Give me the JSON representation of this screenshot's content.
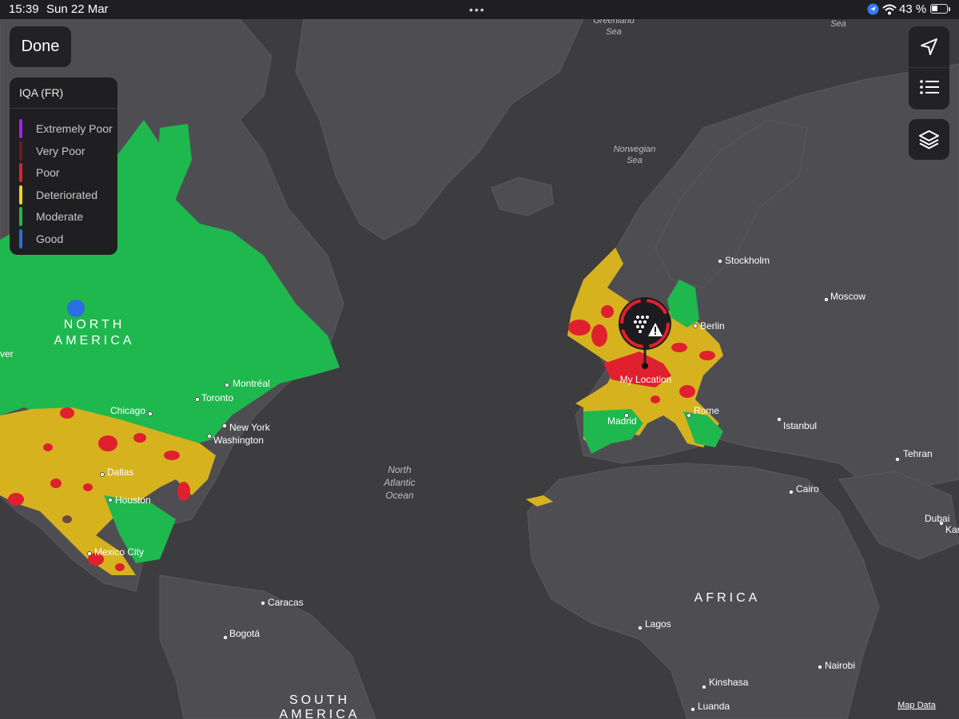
{
  "status_bar": {
    "time": "15:39",
    "date": "Sun 22 Mar",
    "battery_text": "43 %",
    "battery_level": 0.43
  },
  "done_button": {
    "label": "Done"
  },
  "legend": {
    "title": "IQA (FR)",
    "items": [
      {
        "label": "Extremely Poor",
        "color": "#a020f0"
      },
      {
        "label": "Very Poor",
        "color": "#6b1a1f"
      },
      {
        "label": "Poor",
        "color": "#e0202e"
      },
      {
        "label": "Deteriorated",
        "color": "#f2d024"
      },
      {
        "label": "Moderate",
        "color": "#1fb84e"
      },
      {
        "label": "Good",
        "color": "#2a6fe0"
      }
    ]
  },
  "map": {
    "region_labels": {
      "north_america": [
        "NORTH",
        "AMERICA"
      ],
      "south_america": [
        "SOUTH",
        "AMERICA"
      ],
      "africa": "AFRICA"
    },
    "water_labels": {
      "greenland_sea": [
        "Greenland",
        "Sea"
      ],
      "norwegian_sea": [
        "Norwegian",
        "Sea"
      ],
      "north_atlantic": [
        "North",
        "Atlantic",
        "Ocean"
      ],
      "sea_partial": "Sea"
    },
    "cities": {
      "montreal": "Montréal",
      "toronto": "Toronto",
      "chicago": "Chicago",
      "new_york": "New York",
      "washington": "Washington",
      "dallas": "Dallas",
      "houston": "Houston",
      "mexico_city": "Mexico City",
      "caracas": "Caracas",
      "bogota": "Bogotá",
      "stockholm": "Stockholm",
      "moscow": "Moscow",
      "berlin": "Berlin",
      "madrid": "Madrid",
      "rome": "Rome",
      "istanbul": "Istanbul",
      "tehran": "Tehran",
      "cairo": "Cairo",
      "dubai": "Dubai",
      "karachi_partial": "Kar",
      "lagos": "Lagos",
      "nairobi": "Nairobi",
      "kinshasa": "Kinshasa",
      "luanda": "Luanda",
      "denver_partial": "ver"
    },
    "my_location_label": "My Location",
    "attribution": "Map Data"
  },
  "colors": {
    "ocean": "#3d3d40",
    "land": "#4e4e52",
    "moderate": "#1fb84e",
    "deteriorated": "#d6b21f",
    "poor": "#e0202e",
    "good": "#2a6fe0"
  },
  "icons": {
    "location_arrow": "location-arrow-icon",
    "list": "list-icon",
    "layers": "layers-icon",
    "air_quality_marker": "air-quality-warning-icon"
  }
}
